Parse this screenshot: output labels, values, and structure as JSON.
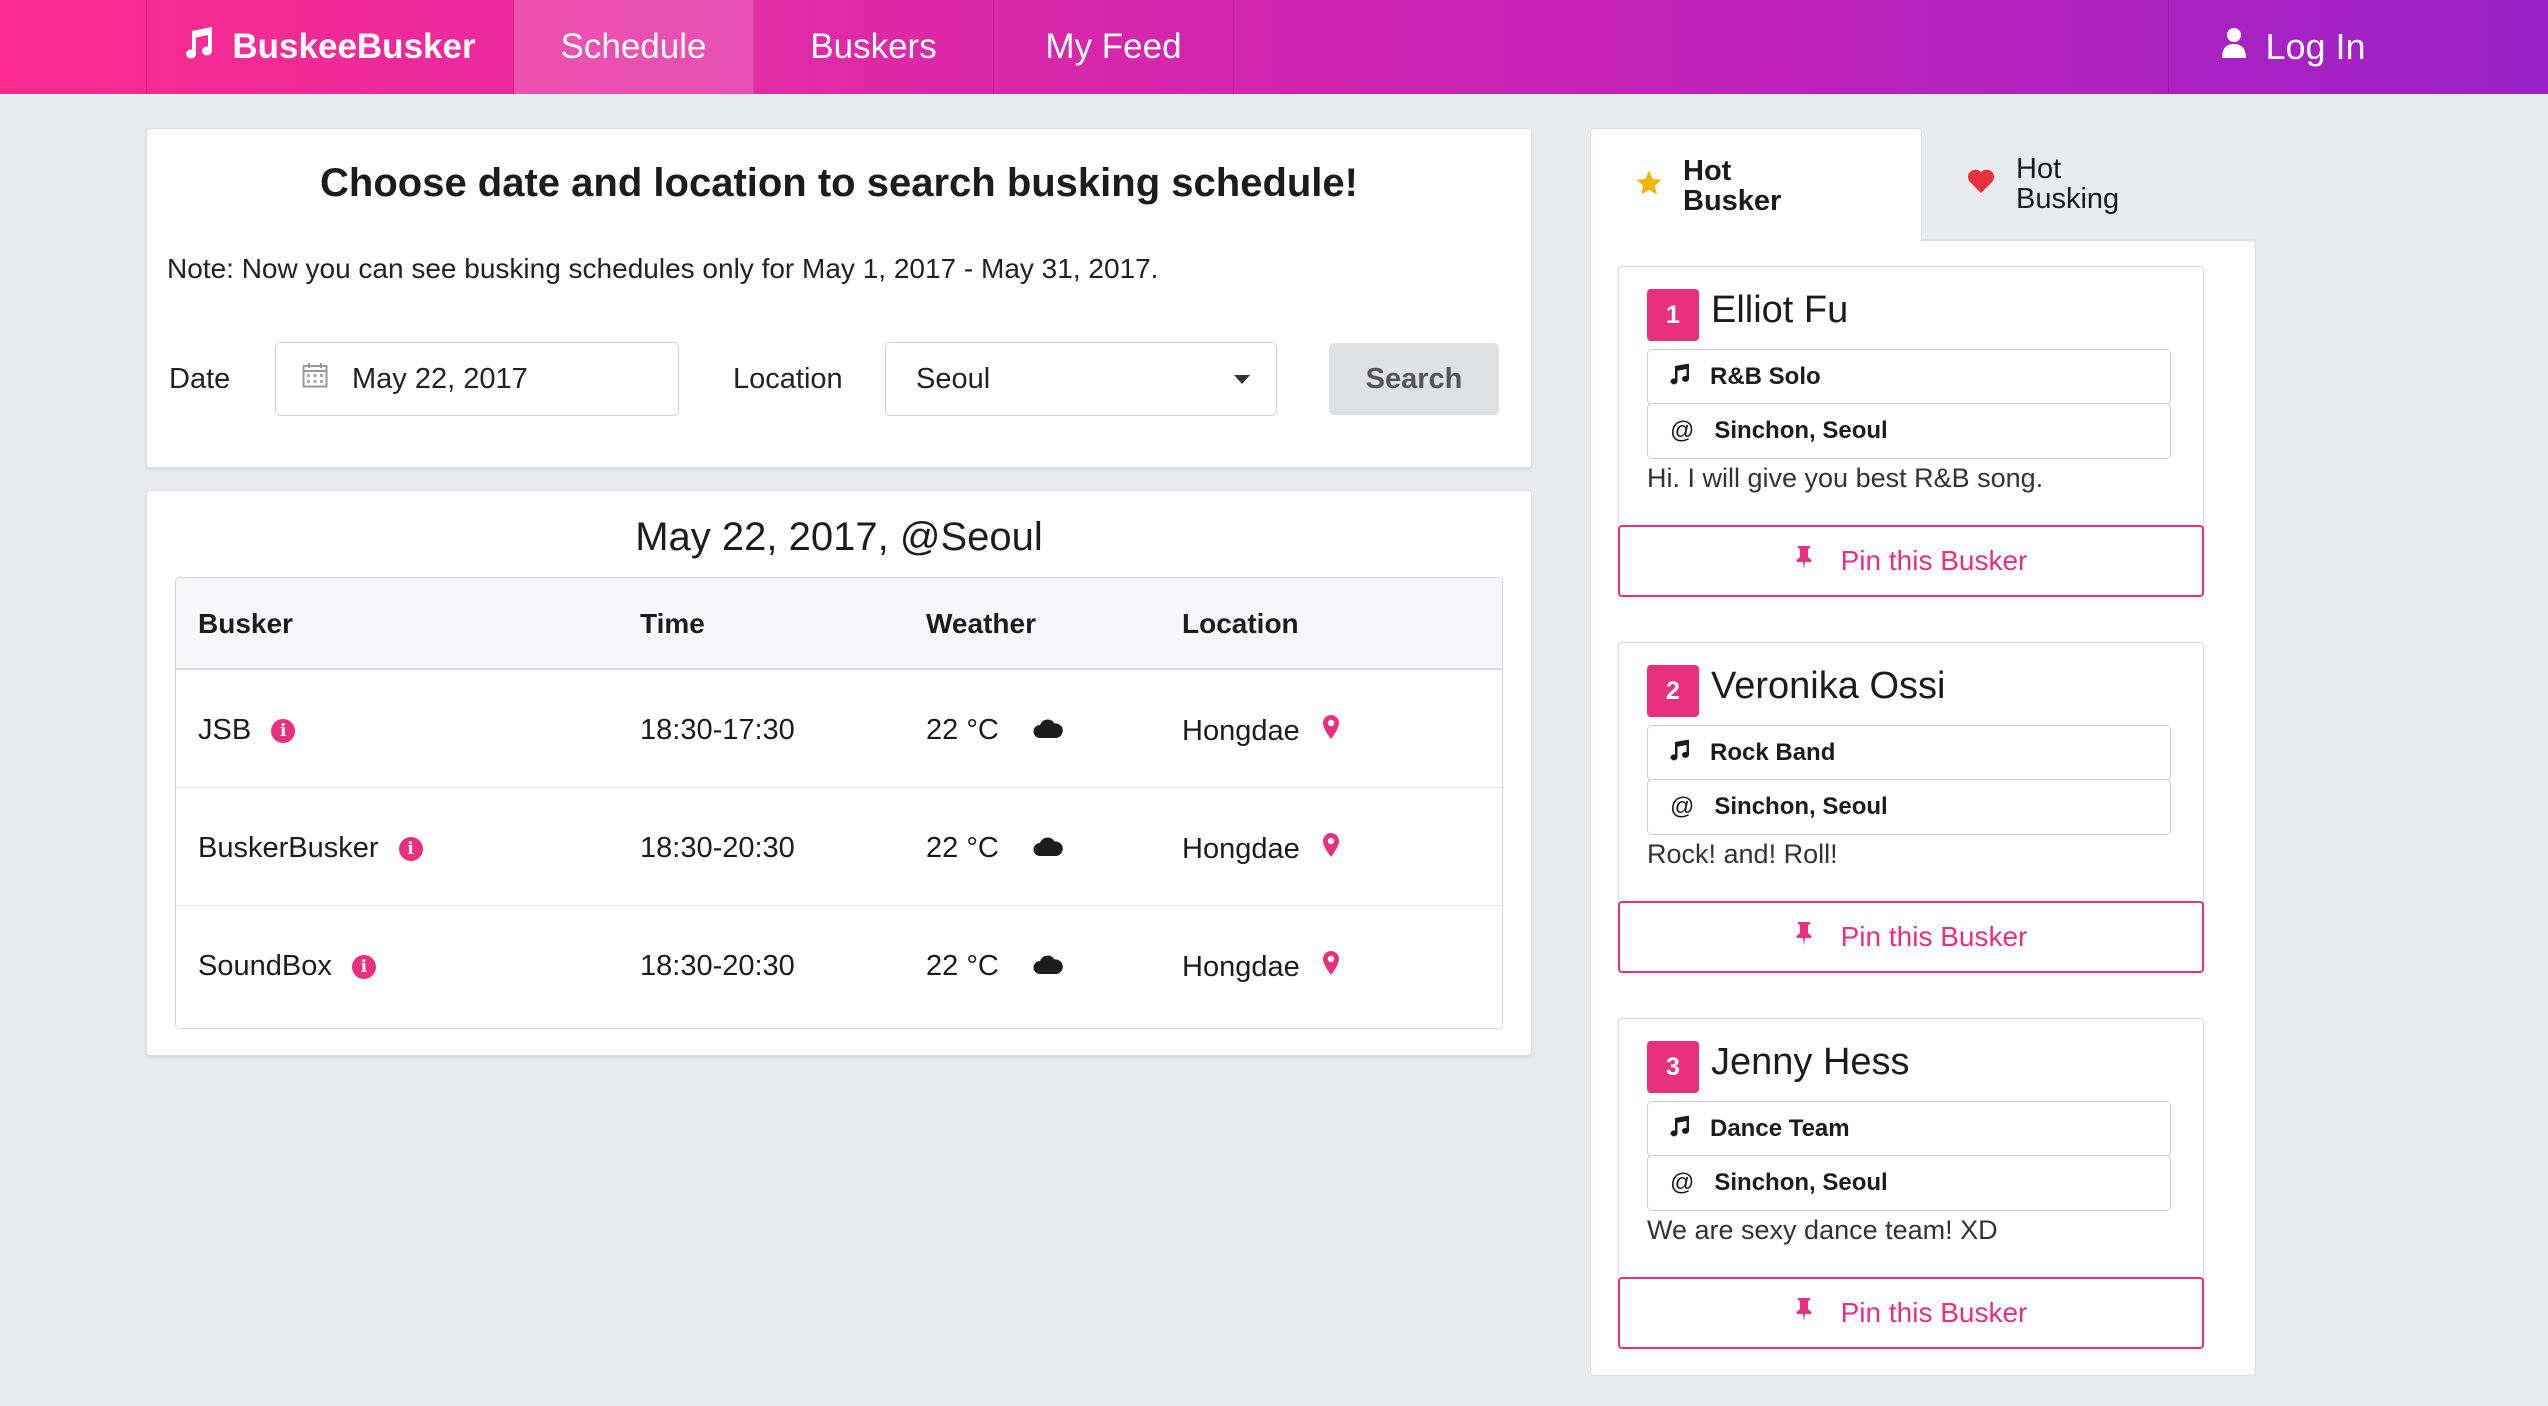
{
  "nav": {
    "brand": "BuskeeBusker",
    "schedule": "Schedule",
    "buskers": "Buskers",
    "feed": "My Feed",
    "login": "Log In"
  },
  "search": {
    "title": "Choose date and location to search busking schedule!",
    "note": "Note: Now you can see busking schedules only for May 1, 2017 - May 31, 2017.",
    "date_label": "Date",
    "date_value": "May 22, 2017",
    "location_label": "Location",
    "location_value": "Seoul",
    "button": "Search"
  },
  "results": {
    "title": "May 22, 2017, @Seoul",
    "headers": [
      "Busker",
      "Time",
      "Weather",
      "Location"
    ],
    "rows": [
      {
        "busker": "JSB",
        "time": "18:30-17:30",
        "weather": "22 °C",
        "location": "Hongdae"
      },
      {
        "busker": "BuskerBusker",
        "time": "18:30-20:30",
        "weather": "22 °C",
        "location": "Hongdae"
      },
      {
        "busker": "SoundBox",
        "time": "18:30-20:30",
        "weather": "22 °C",
        "location": "Hongdae"
      }
    ]
  },
  "sidebar": {
    "tab_busker_line1": "Hot",
    "tab_busker_line2": "Busker",
    "tab_busking_line1": "Hot",
    "tab_busking_line2": "Busking",
    "cards": [
      {
        "rank": "1",
        "name": "Elliot Fu",
        "genre": "R&B Solo",
        "place": "Sinchon, Seoul",
        "desc": "Hi. I will give you best R&B song.",
        "pin": "Pin this Busker"
      },
      {
        "rank": "2",
        "name": "Veronika Ossi",
        "genre": "Rock Band",
        "place": "Sinchon, Seoul",
        "desc": "Rock! and! Roll!",
        "pin": "Pin this Busker"
      },
      {
        "rank": "3",
        "name": "Jenny Hess",
        "genre": "Dance Team",
        "place": "Sinchon, Seoul",
        "desc": "We are sexy dance team! XD",
        "pin": "Pin this Busker"
      }
    ]
  },
  "colors": {
    "accent": "#e8307f",
    "nav_start": "#fb2b8e",
    "nav_end": "#9a22c8",
    "star": "#f5b301",
    "heart": "#e8303f"
  },
  "icons": {
    "brand": "music-note-icon",
    "login": "user-icon",
    "date": "calendar-icon",
    "info": "info-circle-icon",
    "weather": "cloud-icon",
    "location": "map-pin-icon",
    "genre": "music-note-icon",
    "pin": "thumbtack-icon",
    "tab_busker": "star-icon",
    "tab_busking": "heart-icon"
  }
}
